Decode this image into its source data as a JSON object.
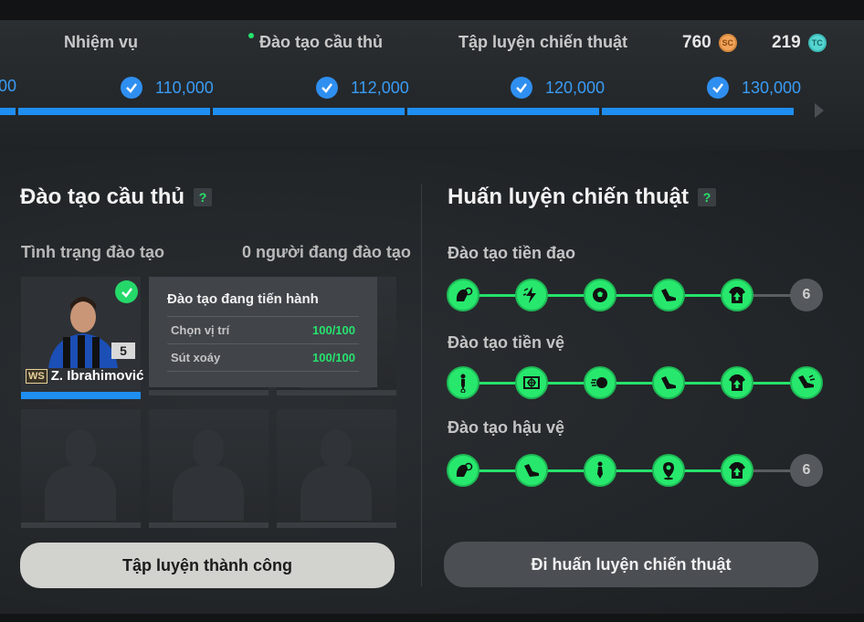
{
  "header": {
    "tabs": [
      {
        "label": "Nhiệm vụ"
      },
      {
        "label": "Đào tạo cầu thủ"
      },
      {
        "label": "Tập luyện chiến thuật"
      }
    ],
    "currency": {
      "sc": {
        "value": "760",
        "code": "SC",
        "color": "#f2a35a"
      },
      "tc": {
        "value": "219",
        "code": "TC",
        "color": "#55d6d2"
      }
    },
    "milestones": [
      {
        "label": "00"
      },
      {
        "label": "110,000"
      },
      {
        "label": "112,000"
      },
      {
        "label": "120,000"
      },
      {
        "label": "130,000"
      }
    ],
    "accent_color": "#1f8ef1"
  },
  "player_training": {
    "title": "Đào tạo cầu thủ",
    "help": "?",
    "status_label": "Tình trạng đào tạo",
    "status_value": "0 người đang đào tạo",
    "player": {
      "name": "Z. Ibrahimović",
      "season_badge": "WS",
      "level": "5"
    },
    "popup": {
      "title": "Đào tạo đang tiến hành",
      "rows": [
        {
          "label": "Chọn vị trí",
          "value": "100/100"
        },
        {
          "label": "Sút xoáy",
          "value": "100/100"
        }
      ]
    },
    "button": "Tập luyện thành công"
  },
  "tactical_training": {
    "title": "Huấn luyện chiến thuật",
    "help": "?",
    "tracks": [
      {
        "label": "Đào tạo tiền đạo",
        "icons": [
          "head-ball-icon",
          "lightning-icon",
          "ball-icon",
          "boot-icon",
          "jersey-up-icon"
        ],
        "remaining": "6"
      },
      {
        "label": "Đào tạo tiền vệ",
        "icons": [
          "player-pass-icon",
          "goal-target-icon",
          "fast-ball-icon",
          "boot-icon",
          "jersey-up-icon",
          "boot-kick-icon"
        ],
        "remaining": ""
      },
      {
        "label": "Đào tạo hậu vệ",
        "icons": [
          "head-ball-icon",
          "boot-icon",
          "player-tie-icon",
          "location-pin-icon",
          "jersey-up-icon"
        ],
        "remaining": "6"
      }
    ],
    "button": "Đi huấn luyện chiến thuật",
    "node_color": "#27e86d"
  }
}
